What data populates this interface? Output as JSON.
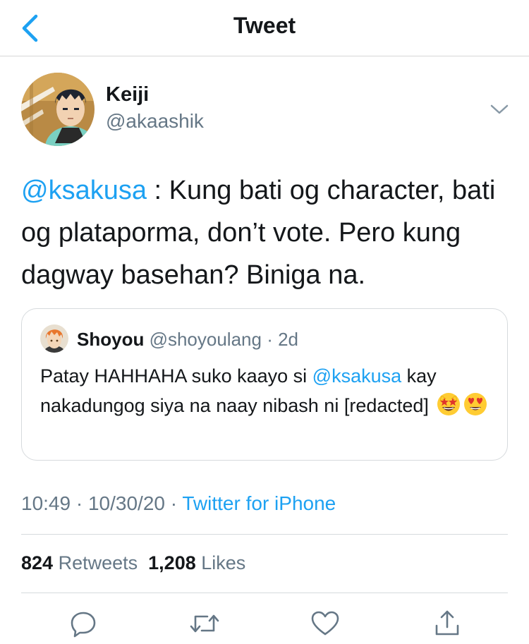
{
  "header": {
    "title": "Tweet",
    "back_icon": "chevron-left-icon"
  },
  "tweet": {
    "author_name": "Keiji",
    "author_handle": "@akaashik",
    "text_mention": "@ksakusa",
    "text_body": " : Kung bati og character, bati og plataporma, don’t vote. Pero kung dagway basehan? Biniga na.",
    "time": "10:49",
    "sep1": " · ",
    "date": "10/30/20",
    "sep2": " · ",
    "source": "Twitter for iPhone"
  },
  "quote": {
    "name": "Shoyou",
    "handle": "@shoyoulang",
    "dot": " · ",
    "age": "2d",
    "text_before": "Patay HAHHAHA suko kaayo si ",
    "text_mention": "@ksakusa",
    "text_after": " kay nakadungog siya na naay nibash ni [redacted] ",
    "emojis": [
      "star-struck",
      "heart-eyes"
    ]
  },
  "stats": {
    "retweets_count": "824",
    "retweets_label": "Retweets",
    "likes_count": "1,208",
    "likes_label": "Likes"
  },
  "actions": [
    "reply-icon",
    "retweet-icon",
    "like-icon",
    "share-icon"
  ],
  "colors": {
    "accent": "#1da1f2",
    "text": "#14171a",
    "secondary": "#657786",
    "border": "#d6dadd"
  }
}
